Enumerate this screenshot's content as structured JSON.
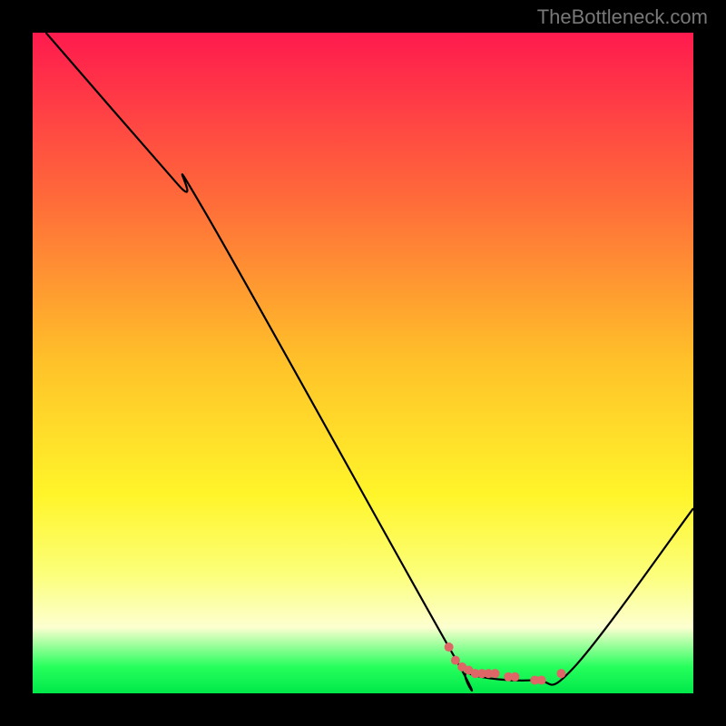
{
  "watermark": "TheBottleneck.com",
  "chart_data": {
    "type": "line",
    "xlabel": "",
    "ylabel": "",
    "xlim": [
      0,
      100
    ],
    "ylim": [
      0,
      100
    ],
    "title": "",
    "annotations": [],
    "background_gradient": {
      "stops": [
        {
          "pos": 0.0,
          "color": "#ff1a4e"
        },
        {
          "pos": 0.25,
          "color": "#ff6a3a"
        },
        {
          "pos": 0.5,
          "color": "#ffc229"
        },
        {
          "pos": 0.7,
          "color": "#fff52a"
        },
        {
          "pos": 0.82,
          "color": "#fcff7a"
        },
        {
          "pos": 0.9,
          "color": "#fdffd0"
        },
        {
          "pos": 0.96,
          "color": "#26ff5c"
        },
        {
          "pos": 1.0,
          "color": "#00e84a"
        }
      ]
    },
    "series": [
      {
        "name": "bottleneck-curve",
        "color": "#000000",
        "points": [
          {
            "x": 2,
            "y": 100
          },
          {
            "x": 22,
            "y": 77
          },
          {
            "x": 26,
            "y": 73
          },
          {
            "x": 63,
            "y": 7
          },
          {
            "x": 66,
            "y": 3
          },
          {
            "x": 76,
            "y": 2
          },
          {
            "x": 82,
            "y": 4
          },
          {
            "x": 100,
            "y": 28
          }
        ]
      }
    ],
    "highlight_dots": {
      "color": "#de6666",
      "radius": 5,
      "points": [
        {
          "x": 63,
          "y": 7
        },
        {
          "x": 64,
          "y": 5
        },
        {
          "x": 65,
          "y": 4
        },
        {
          "x": 66,
          "y": 3.5
        },
        {
          "x": 67,
          "y": 3
        },
        {
          "x": 68,
          "y": 3
        },
        {
          "x": 69,
          "y": 3
        },
        {
          "x": 70,
          "y": 3
        },
        {
          "x": 72,
          "y": 2.5
        },
        {
          "x": 73,
          "y": 2.5
        },
        {
          "x": 76,
          "y": 2
        },
        {
          "x": 77,
          "y": 2
        },
        {
          "x": 80,
          "y": 3
        }
      ]
    }
  }
}
